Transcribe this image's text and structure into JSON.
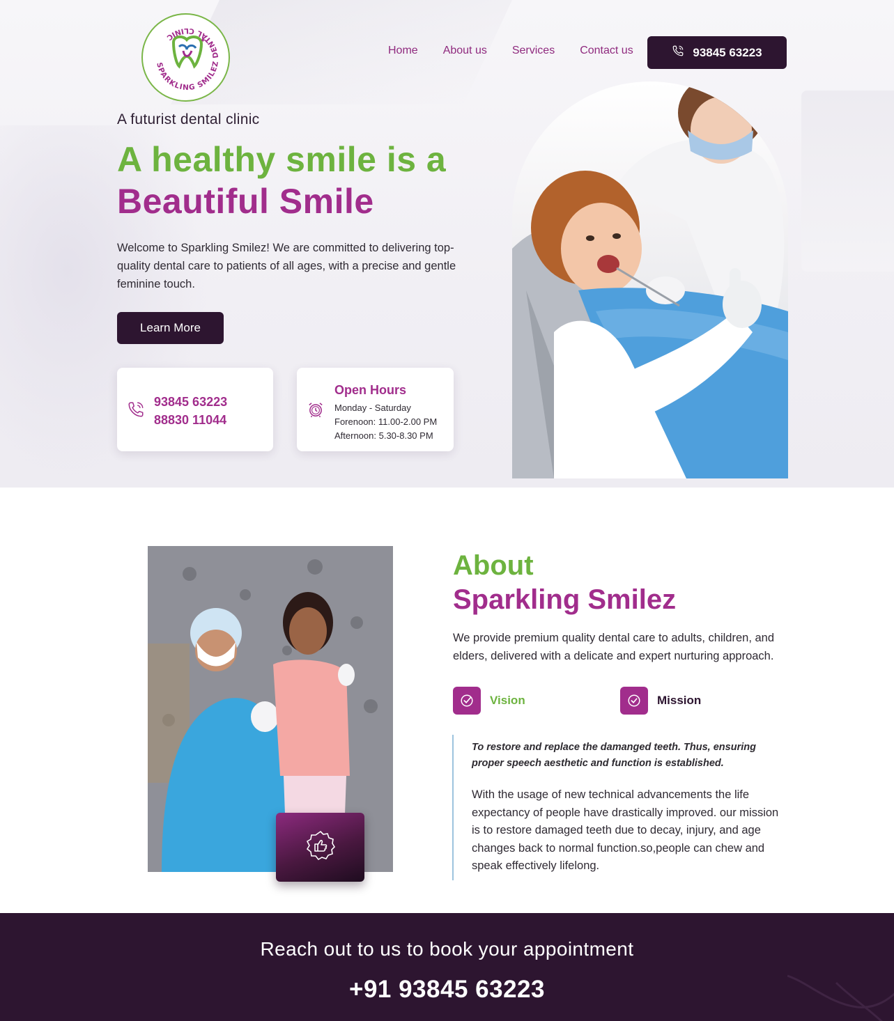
{
  "brand": {
    "logo_text": "SPARKLING SMILEZ DENTAL CLINIC",
    "colors": {
      "green": "#6db33f",
      "purple": "#a12d8c",
      "dark": "#2d1530"
    }
  },
  "nav": {
    "items": [
      "Home",
      "About us",
      "Services",
      "Contact us"
    ],
    "call_button": "93845 63223",
    "call_icon": "phone-icon"
  },
  "hero": {
    "tagline": "A futurist dental clinic",
    "headline_green": "A healthy smile is a",
    "headline_purple": "Beautiful Smile",
    "intro": "Welcome to Sparkling Smilez! We are committed to delivering top-quality dental care to patients of all ages, with a precise and gentle feminine touch.",
    "learn_more": "Learn More",
    "phone_card": {
      "icon": "phone-icon",
      "phone1": "93845 63223",
      "phone2": "88830 11044"
    },
    "hours_card": {
      "icon": "alarm-clock-icon",
      "title": "Open Hours",
      "days": "Monday - Saturday",
      "forenoon": "Forenoon: 11.00-2.00 PM",
      "afternoon": "Afternoon: 5.30-8.30 PM"
    }
  },
  "about": {
    "heading_green": "About",
    "heading_purple": "Sparkling Smilez",
    "text": "We provide premium quality dental care to adults, children, and elders, delivered with a delicate and expert nurturing approach.",
    "badge_icon": "thumbs-up-badge-icon",
    "tabs": [
      {
        "label": "Vision",
        "icon": "check-shield-icon",
        "active": true
      },
      {
        "label": "Mission",
        "icon": "check-circle-icon",
        "active": false
      }
    ],
    "quote": "To restore and replace the damanged teeth. Thus, ensuring proper speech aesthetic and function is established.",
    "mission_text": "With the usage of new technical advancements the life expectancy of people have drastically improved.  our mission is to restore damaged teeth due to decay,  injury, and age changes back to normal function.so,people can chew and speak effectively lifelong."
  },
  "cta": {
    "title": "Reach out to us to book your appointment",
    "phone": "+91 93845 63223"
  }
}
